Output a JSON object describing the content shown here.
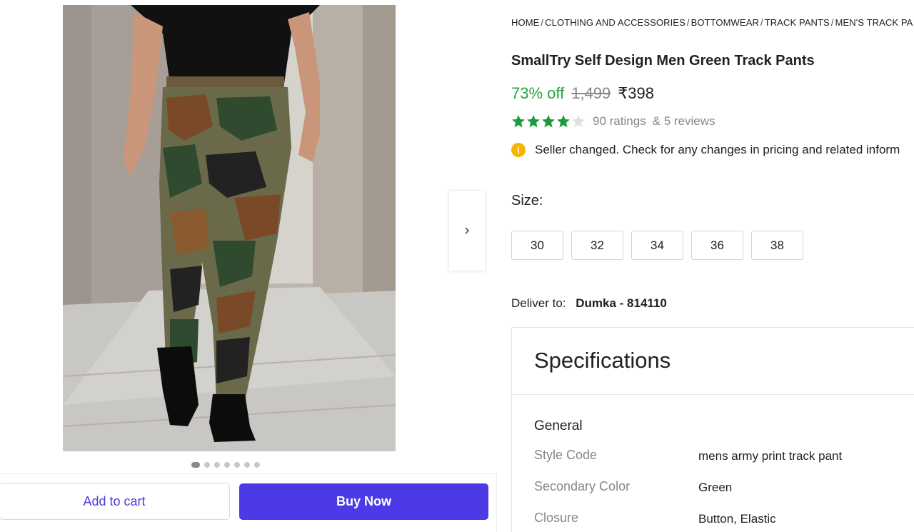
{
  "gallery": {
    "image_alt": "Man walking in green camouflage track pants",
    "dots_count": 7,
    "active_dot": 0,
    "next_icon": "chevron-right-icon"
  },
  "actions": {
    "add_to_cart": "Add to cart",
    "buy_now": "Buy Now"
  },
  "breadcrumb": [
    "HOME",
    "CLOTHING AND ACCESSORIES",
    "BOTTOMWEAR",
    "TRACK PANTS",
    "MEN'S TRACK PA"
  ],
  "product": {
    "title": "SmallTry Self Design Men Green Track Pants",
    "discount": "73% off",
    "mrp": "1,499",
    "price": "₹398"
  },
  "rating": {
    "stars": 4,
    "ratings_text": "90 ratings",
    "reviews_text": "& 5 reviews"
  },
  "notice": {
    "icon": "info-icon",
    "text": "Seller changed. Check for any changes in pricing and related inform"
  },
  "size": {
    "label": "Size:",
    "options": [
      "30",
      "32",
      "34",
      "36",
      "38"
    ]
  },
  "delivery": {
    "label": "Deliver to:",
    "place": "Dumka - 814110"
  },
  "specifications": {
    "title": "Specifications",
    "group": "General",
    "rows": [
      {
        "key": "Style Code",
        "value": "mens army print track pant"
      },
      {
        "key": "Secondary Color",
        "value": "Green"
      },
      {
        "key": "Closure",
        "value": "Button, Elastic"
      }
    ]
  },
  "colors": {
    "accent": "#4b3ae6",
    "discount_green": "#26a541",
    "star_green": "#1a9c3a",
    "info_yellow": "#f8b500"
  }
}
